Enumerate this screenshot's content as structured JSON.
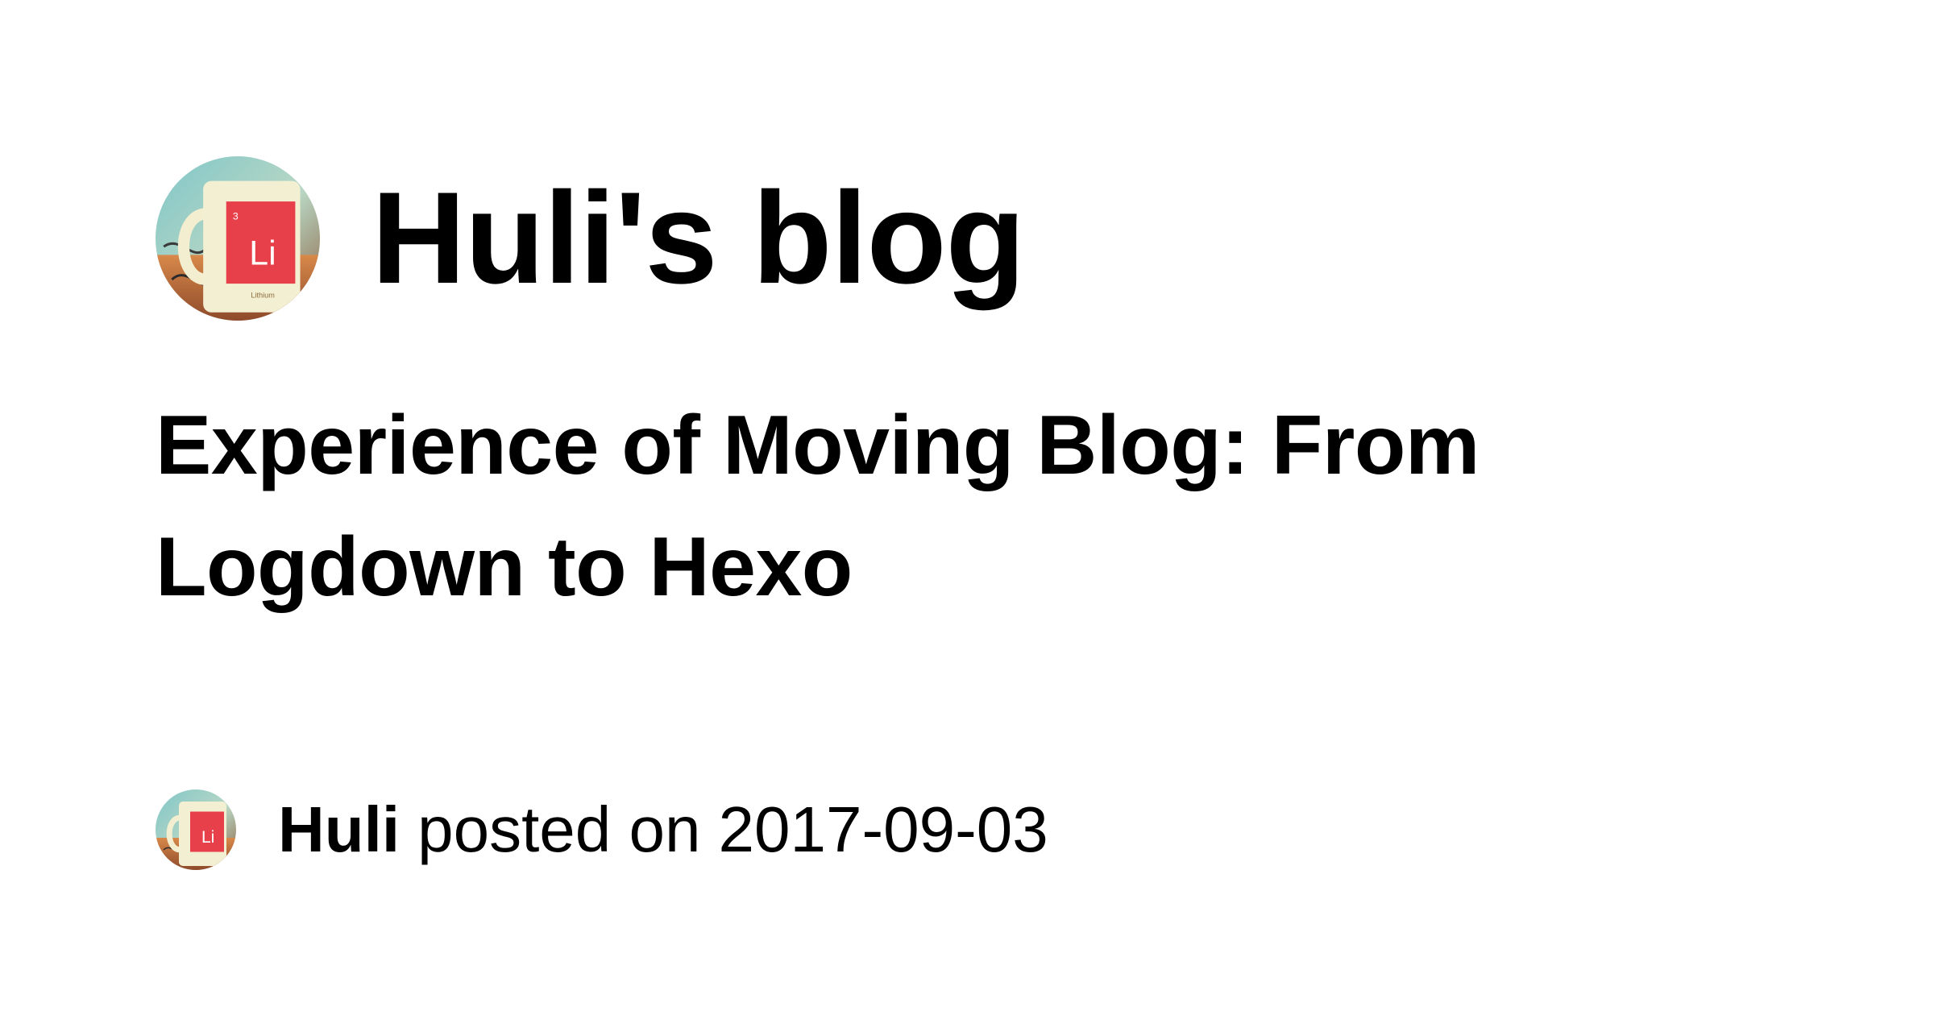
{
  "site": {
    "title": "Huli's blog",
    "avatar_icon": "avatar-mug-icon"
  },
  "post": {
    "title": "Experience of Moving Blog: From Logdown to Hexo"
  },
  "byline": {
    "author": "Huli",
    "posted_on_text": "posted on",
    "date": "2017-09-03",
    "avatar_icon": "avatar-mug-icon"
  },
  "avatar_image": {
    "mug_symbol": "Li",
    "atomic_number": "3",
    "element_name": "Lithium"
  },
  "colors": {
    "text": "#000000",
    "background": "#ffffff",
    "mug_red": "#e8404a"
  }
}
